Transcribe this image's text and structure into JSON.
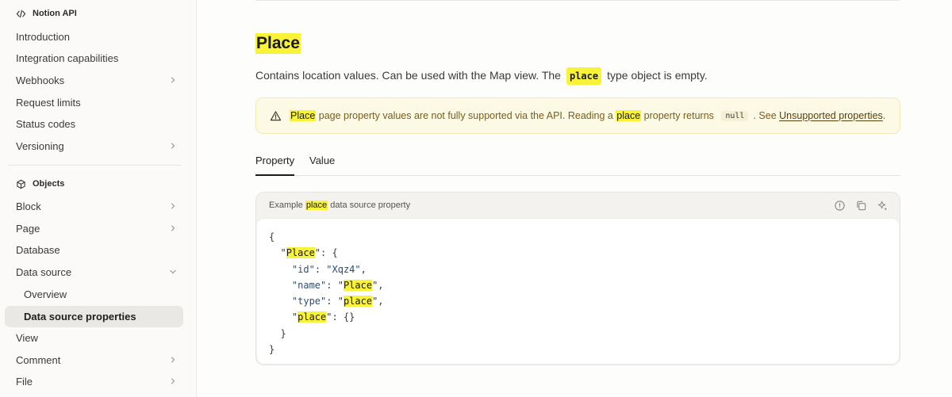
{
  "sidebar": {
    "sections": [
      {
        "title": "Notion API",
        "icon": "code-icon"
      },
      {
        "title": "Objects",
        "icon": "cube-icon"
      }
    ],
    "items_api": [
      {
        "label": "Introduction",
        "has_children": false
      },
      {
        "label": "Integration capabilities",
        "has_children": false
      },
      {
        "label": "Webhooks",
        "has_children": true
      },
      {
        "label": "Request limits",
        "has_children": false
      },
      {
        "label": "Status codes",
        "has_children": false
      },
      {
        "label": "Versioning",
        "has_children": true
      }
    ],
    "items_objects": [
      {
        "label": "Block",
        "has_children": true
      },
      {
        "label": "Page",
        "has_children": true
      },
      {
        "label": "Database",
        "has_children": false
      },
      {
        "label": "Data source",
        "has_children": true,
        "expanded": true
      },
      {
        "label": "Overview",
        "sub": true
      },
      {
        "label": "Data source properties",
        "sub": true,
        "active": true
      },
      {
        "label": "View",
        "has_children": false
      },
      {
        "label": "Comment",
        "has_children": true
      },
      {
        "label": "File",
        "has_children": true
      }
    ]
  },
  "main": {
    "title": "Place",
    "description_before": "Contains location values. Can be used with the Map view. The",
    "description_code": "place",
    "description_after": "type object is empty.",
    "warning": {
      "icon": "warning-triangle-icon",
      "hl1": "Place",
      "text1": " page property values are not fully supported via the API. Reading a ",
      "hl2": "place",
      "text2": " property returns ",
      "code": "null",
      "text3": ". See ",
      "link": "Unsupported properties",
      "text4": "."
    },
    "tabs": [
      {
        "label": "Property",
        "active": true
      },
      {
        "label": "Value",
        "active": false
      }
    ],
    "code_card": {
      "caption_before": "Example ",
      "caption_hl": "place",
      "caption_after": " data source property",
      "tools": [
        "info-icon",
        "copy-icon",
        "ai-sparkle-icon"
      ],
      "lines": [
        "{",
        "  \"Place\": {",
        "    \"id\": \"Xqz4\",",
        "    \"name\": \"Place\",",
        "    \"type\": \"place\",",
        "    \"place\": {}",
        "  }",
        "}"
      ]
    }
  },
  "colors": {
    "highlight": "#f8f238",
    "warning_bg": "#fcfae4",
    "warning_text": "#7a5c1a"
  }
}
